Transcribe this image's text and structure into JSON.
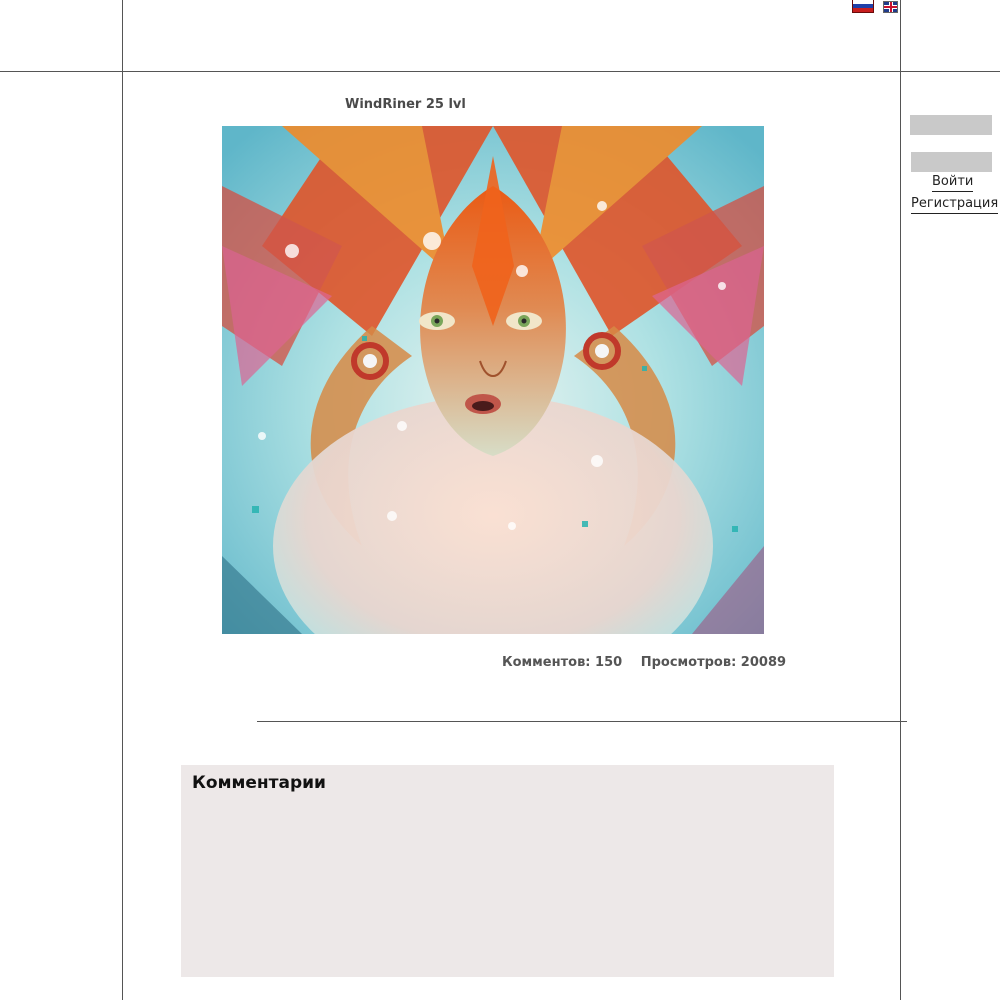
{
  "languages": [
    {
      "code": "ru",
      "label": "Русский"
    },
    {
      "code": "en",
      "label": "English"
    }
  ],
  "artwork": {
    "author_line": "WindRiner 25 lvl"
  },
  "stats": {
    "comments": "Комментов: 150",
    "views": "Просмотров: 20089"
  },
  "auth": {
    "login_label": "Войти",
    "register_label": "Регистрация"
  },
  "comments_section": {
    "title": "Комментарии"
  },
  "colors": {
    "accent_orange": "#e8581c",
    "cyan": "#7fd3dc",
    "panel_bg": "#ede8e8",
    "input_bg": "#c9c9c9"
  }
}
